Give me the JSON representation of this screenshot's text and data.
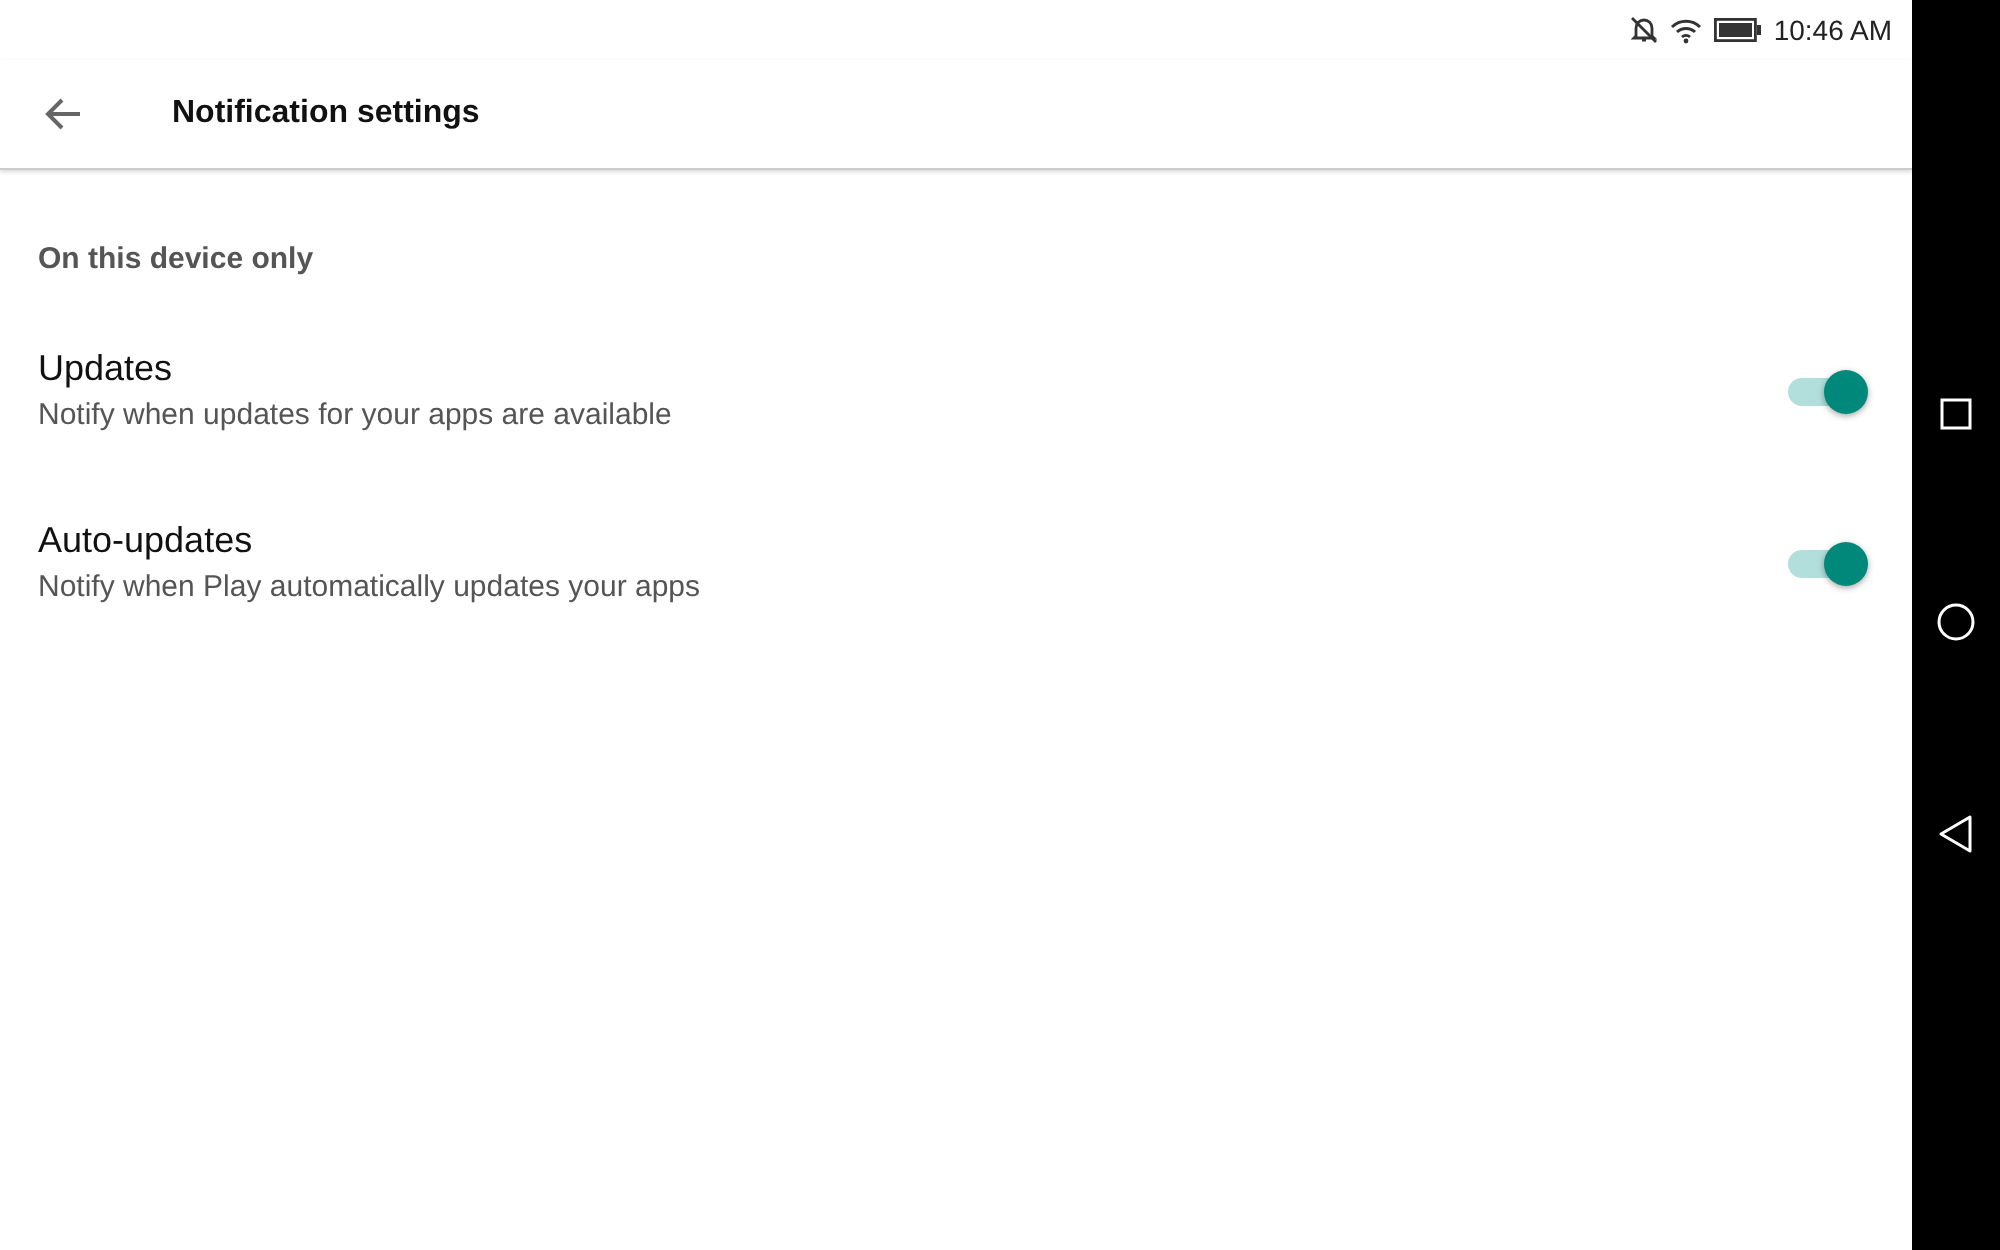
{
  "status_bar": {
    "time": "10:46 AM"
  },
  "app_bar": {
    "title": "Notification settings"
  },
  "section": {
    "header": "On this device only"
  },
  "settings": [
    {
      "title": "Updates",
      "description": "Notify when updates for your apps are available",
      "on": true
    },
    {
      "title": "Auto-updates",
      "description": "Notify when Play automatically updates your apps",
      "on": true
    }
  ]
}
